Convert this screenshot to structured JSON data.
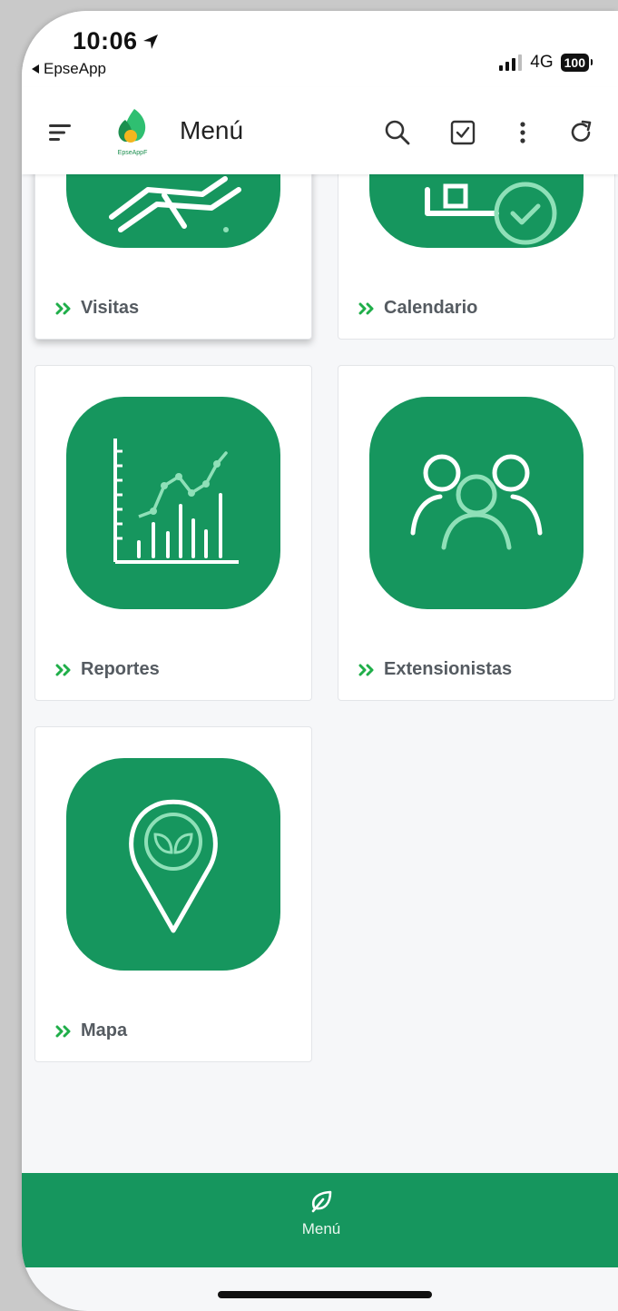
{
  "status_bar": {
    "time": "10:06",
    "back_app": "EpseApp",
    "network": "4G",
    "battery": "100"
  },
  "app_bar": {
    "logo_text": "EpseAppF",
    "title": "Menú"
  },
  "menu_items": [
    {
      "label": "Visitas"
    },
    {
      "label": "Calendario"
    },
    {
      "label": "Reportes"
    },
    {
      "label": "Extensionistas"
    },
    {
      "label": "Mapa"
    }
  ],
  "bottom_nav": {
    "label": "Menú"
  },
  "colors": {
    "primary_green": "#16965e",
    "light_green": "#8fe0b8",
    "chevron_green": "#1fae49"
  }
}
